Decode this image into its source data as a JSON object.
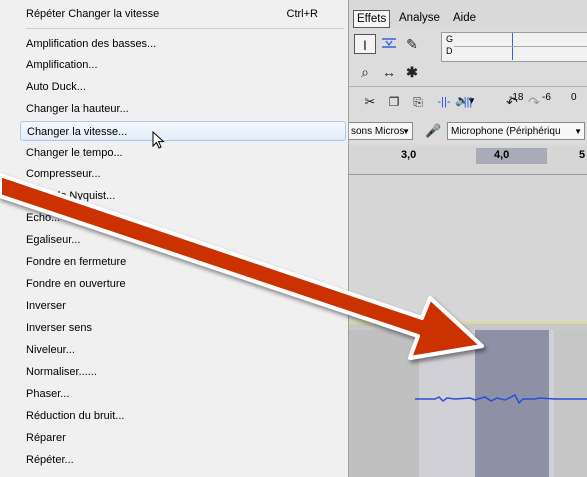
{
  "menu": {
    "repeat_item": {
      "label": "Répéter Changer la vitesse",
      "shortcut": "Ctrl+R"
    },
    "items": [
      "Amplification des basses...",
      "Amplification...",
      "Auto Duck...",
      "Changer la hauteur...",
      "Changer la vitesse...",
      "Changer le tempo...",
      "Compresseur...",
      "Console Nyquist...",
      "Echo...",
      "Egaliseur...",
      "Fondre en fermeture",
      "Fondre en ouverture",
      "Inverser",
      "Inverser sens",
      "Niveleur...",
      "Normaliser......",
      "Phaser...",
      "Réduction du bruit...",
      "Réparer",
      "Répéter..."
    ],
    "highlighted_item": "Changer la vitesse..."
  },
  "menubar": {
    "items": [
      "Effets",
      "Analyse",
      "Aide"
    ],
    "active": "Effets"
  },
  "meter": {
    "channel_top": "G",
    "channel_bottom": "D",
    "db_labels": [
      "-18",
      "-6",
      "0"
    ]
  },
  "devices": {
    "output": "sons Micros",
    "input": "Microphone (Périphériqu"
  },
  "ruler": {
    "ticks": [
      "3,0",
      "4,0",
      "5"
    ]
  },
  "colors": {
    "arrow": "#cc3300",
    "selection": "#8e90a6",
    "waveform": "#2a4fd6",
    "active_menu": "#aac8ee"
  }
}
